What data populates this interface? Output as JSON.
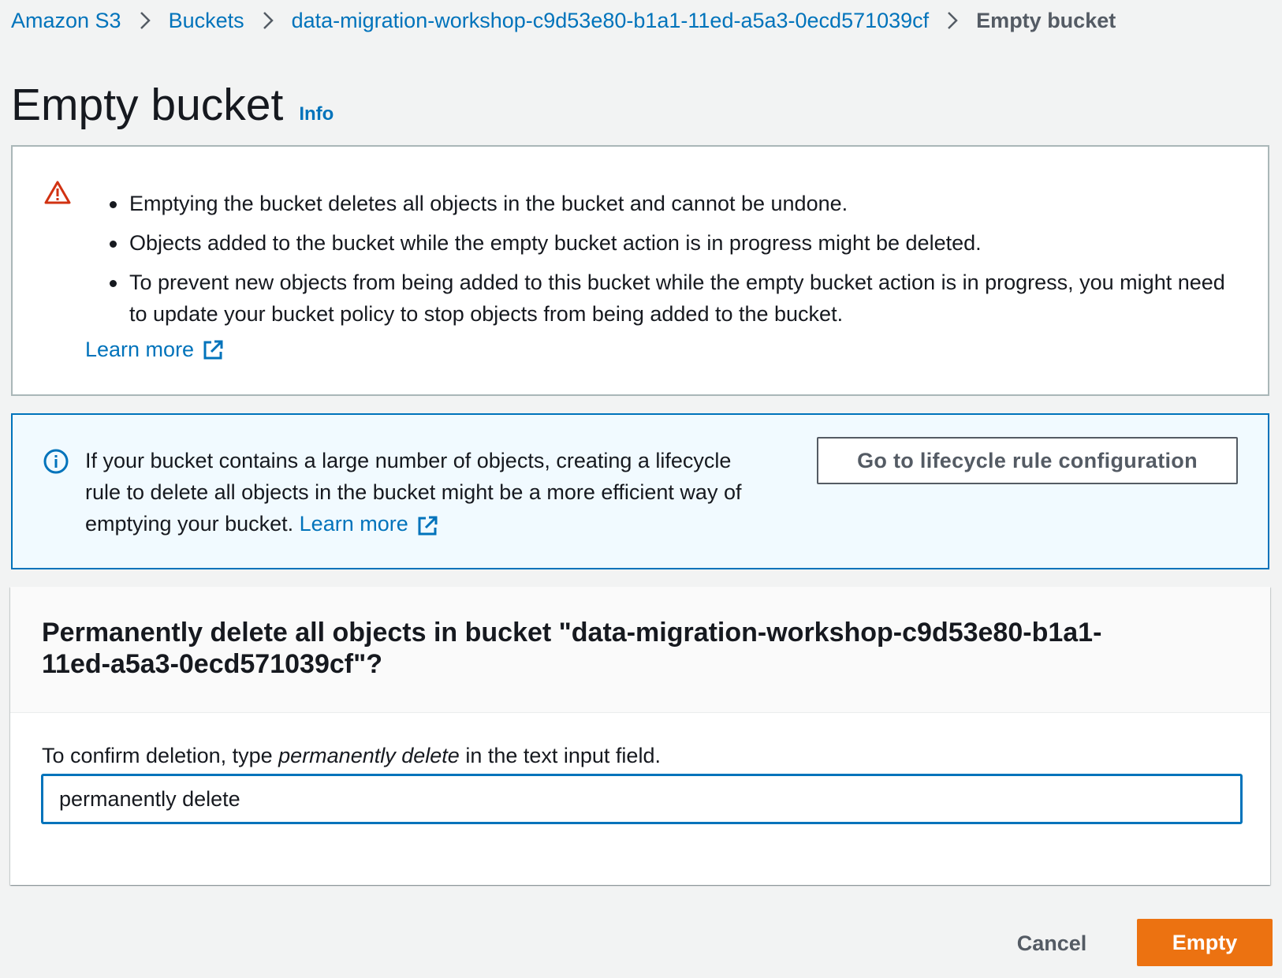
{
  "breadcrumb": {
    "items": [
      {
        "label": "Amazon S3"
      },
      {
        "label": "Buckets"
      },
      {
        "label": "data-migration-workshop-c9d53e80-b1a1-11ed-a5a3-0ecd571039cf"
      }
    ],
    "current": "Empty bucket"
  },
  "header": {
    "title": "Empty bucket",
    "info_label": "Info"
  },
  "warning": {
    "items": [
      "Emptying the bucket deletes all objects in the bucket and cannot be undone.",
      "Objects added to the bucket while the empty bucket action is in progress might be deleted.",
      "To prevent new objects from being added to this bucket while the empty bucket action is in progress, you might need to update your bucket policy to stop objects from being added to the bucket."
    ],
    "learn_more": "Learn more"
  },
  "info": {
    "text": "If your bucket contains a large number of objects, creating a lifecycle rule to delete all objects in the bucket might be a more efficient way of emptying your bucket.",
    "learn_more": "Learn more",
    "button_label": "Go to lifecycle rule configuration"
  },
  "confirm": {
    "heading": "Permanently delete all objects in bucket \"data-migration-workshop-c9d53e80-b1a1-11ed-a5a3-0ecd571039cf\"?",
    "instruction_prefix": "To confirm deletion, type ",
    "instruction_keyword": "permanently delete",
    "instruction_suffix": " in the text input field.",
    "input_value": "permanently delete"
  },
  "actions": {
    "cancel_label": "Cancel",
    "empty_label": "Empty"
  },
  "colors": {
    "link": "#0073bb",
    "primary_button": "#ec7211",
    "warning_icon": "#d13212",
    "info_border": "#0073bb",
    "info_background": "#f1faff",
    "page_background": "#f2f3f3"
  },
  "icons": {
    "breadcrumb_separator": "chevron-right-icon",
    "warning": "warning-triangle-icon",
    "info": "info-circle-icon",
    "external_link": "external-link-icon"
  }
}
